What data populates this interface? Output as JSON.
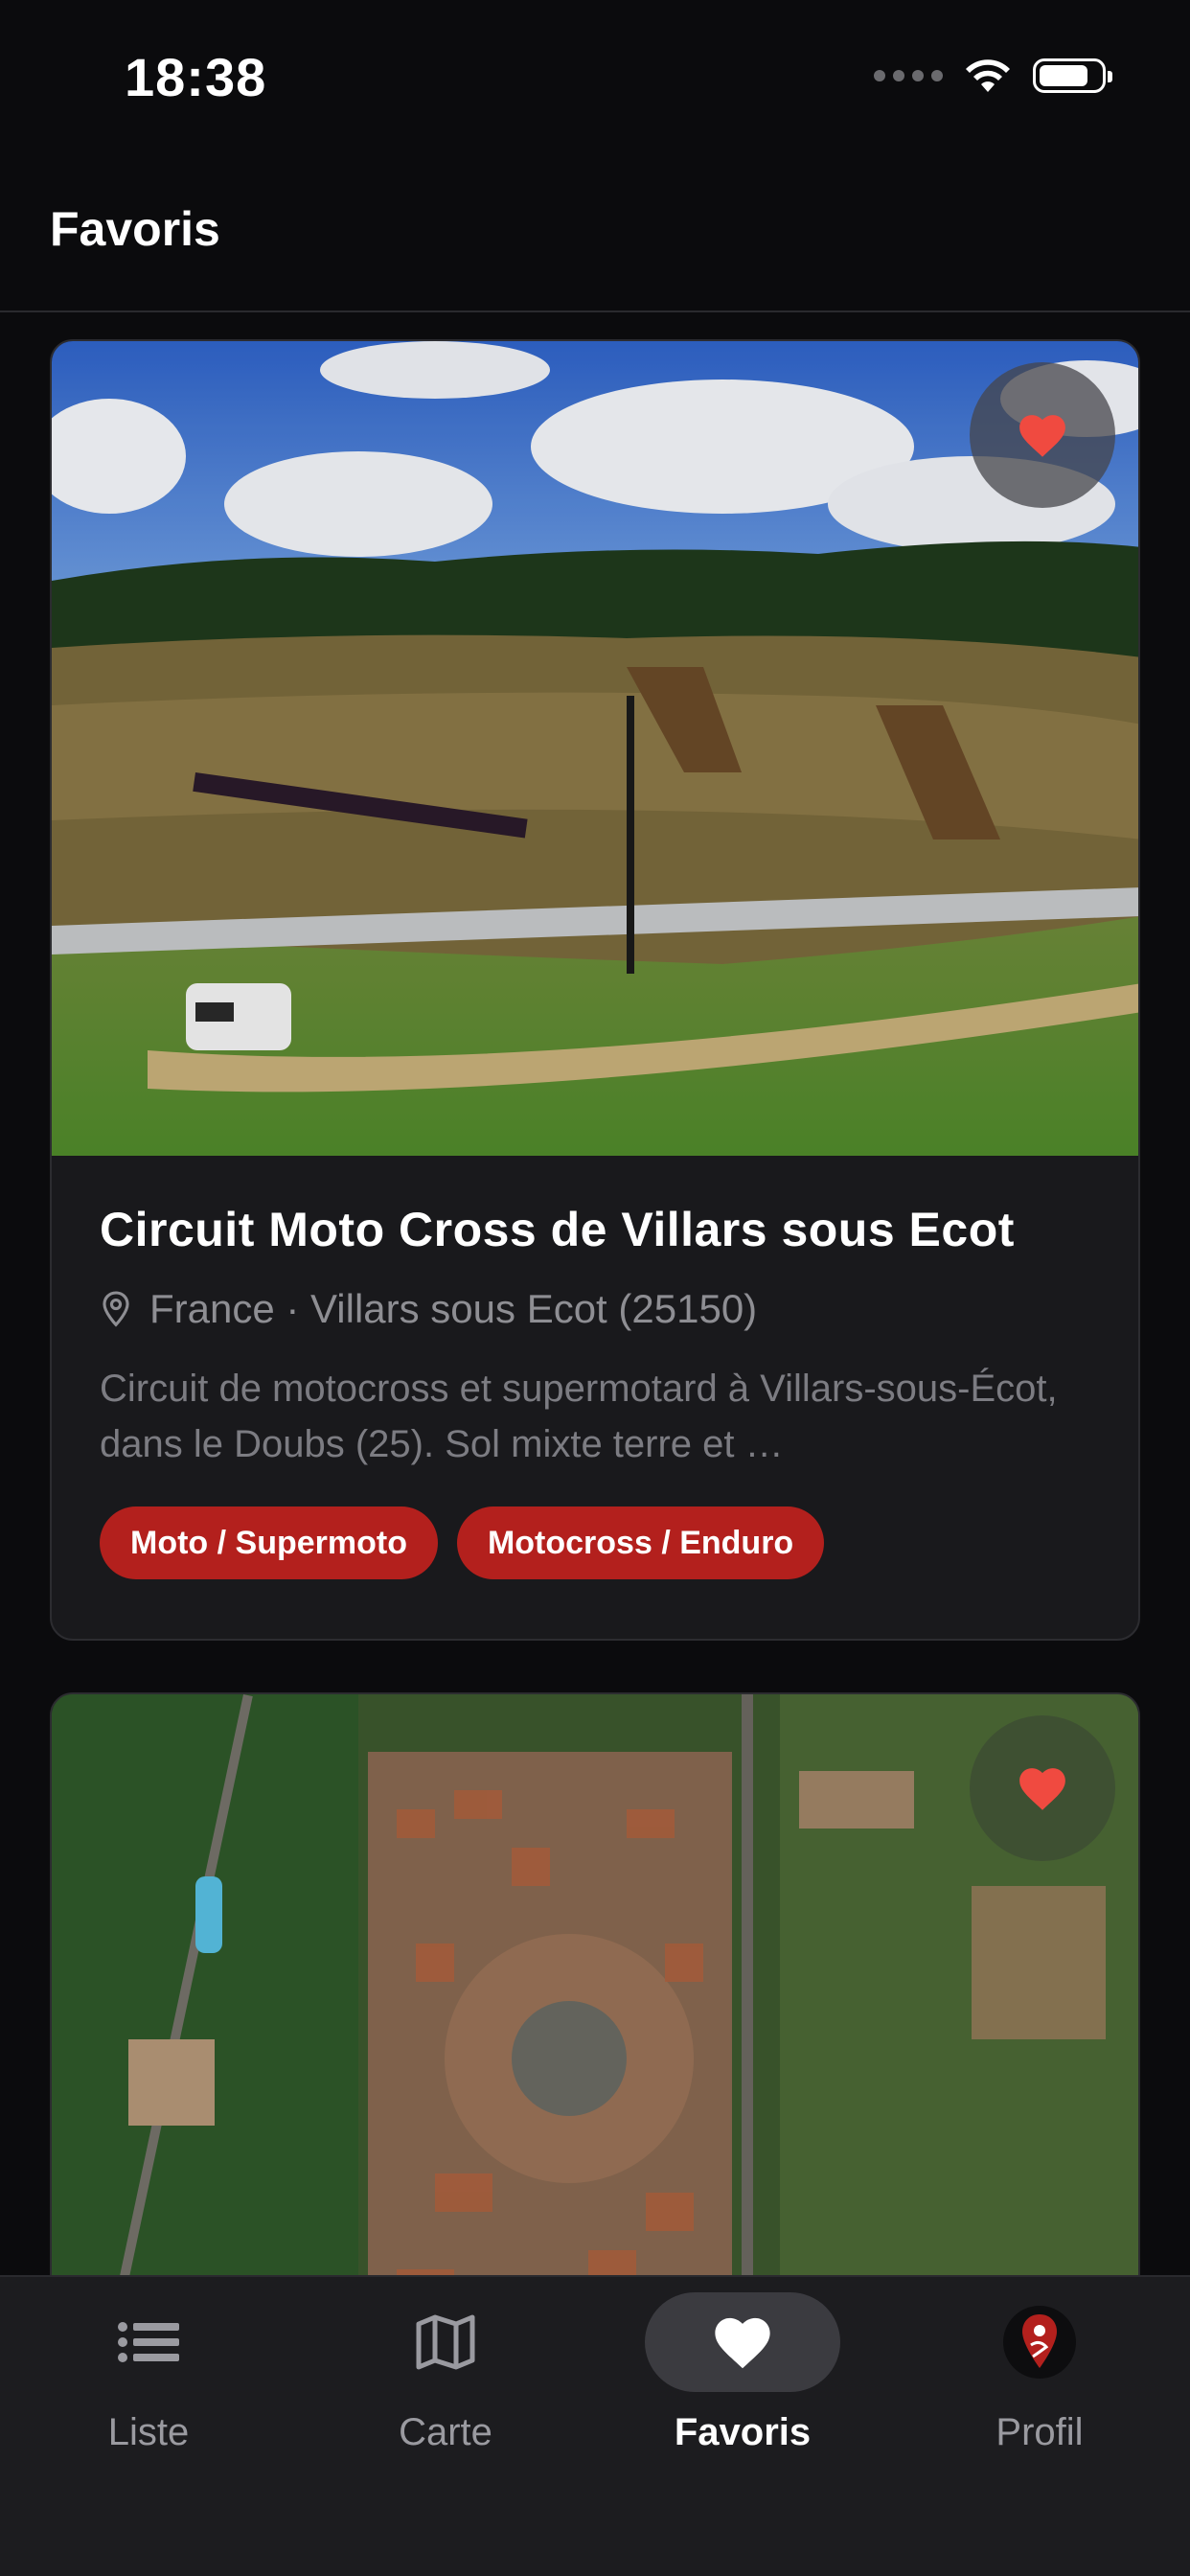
{
  "status_bar": {
    "time": "18:38",
    "icons": [
      "signal-dots-icon",
      "wifi-icon",
      "battery-icon"
    ]
  },
  "header": {
    "title": "Favoris"
  },
  "cards": [
    {
      "image_icon": "motocross-track-photo",
      "favorite": true,
      "title": "Circuit Moto Cross de Villars sous Ecot",
      "location": "France · Villars sous Ecot (25150)",
      "description": "Circuit de motocross et supermotard à Villars-sous-Écot, dans le Doubs (25). Sol mixte terre et …",
      "tags": [
        "Moto / Supermoto",
        "Motocross / Enduro"
      ]
    },
    {
      "image_icon": "aerial-town-photo",
      "favorite": true
    }
  ],
  "bottom_nav": {
    "items": [
      {
        "label": "Liste",
        "icon": "list-icon",
        "active": false
      },
      {
        "label": "Carte",
        "icon": "map-icon",
        "active": false
      },
      {
        "label": "Favoris",
        "icon": "heart-icon",
        "active": true
      },
      {
        "label": "Profil",
        "icon": "profile-avatar-icon",
        "active": false
      }
    ]
  },
  "colors": {
    "accent": "#b3201d",
    "heart": "#f04a40",
    "background": "#0b0b0d",
    "card": "#19191c"
  }
}
